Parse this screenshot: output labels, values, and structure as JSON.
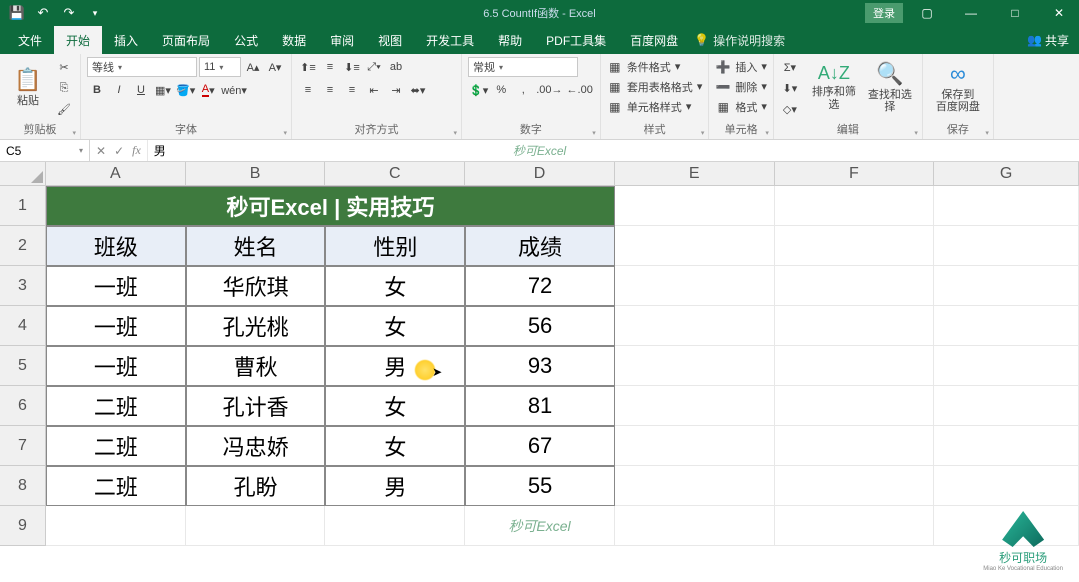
{
  "titlebar": {
    "doc_title": "6.5 CountIf函数 - Excel",
    "login": "登录"
  },
  "tabs": {
    "file": "文件",
    "home": "开始",
    "insert": "插入",
    "layout": "页面布局",
    "formula": "公式",
    "data": "数据",
    "review": "审阅",
    "view": "视图",
    "dev": "开发工具",
    "help": "帮助",
    "pdf": "PDF工具集",
    "baidu": "百度网盘",
    "tellme": "操作说明搜索",
    "share": "共享"
  },
  "ribbon": {
    "clipboard": {
      "paste": "粘贴",
      "label": "剪贴板"
    },
    "font": {
      "name": "等线",
      "size": "11",
      "label": "字体",
      "bold": "B",
      "italic": "I",
      "underline": "U"
    },
    "align": {
      "label": "对齐方式",
      "wrap": "ab"
    },
    "number": {
      "format": "常规",
      "label": "数字"
    },
    "styles": {
      "cond": "条件格式",
      "table": "套用表格格式",
      "cell": "单元格样式",
      "label": "样式"
    },
    "cells": {
      "insert": "插入",
      "delete": "删除",
      "format": "格式",
      "label": "单元格"
    },
    "editing": {
      "sort": "排序和筛选",
      "find": "查找和选择",
      "label": "编辑"
    },
    "save": {
      "btn": "保存到\n百度网盘",
      "label": "保存"
    }
  },
  "formula_bar": {
    "cell_ref": "C5",
    "value": "男",
    "watermark": "秒可Excel"
  },
  "grid": {
    "col_headers": [
      "A",
      "B",
      "C",
      "D",
      "E",
      "F",
      "G"
    ],
    "row_headers": [
      "1",
      "2",
      "3",
      "4",
      "5",
      "6",
      "7",
      "8",
      "9"
    ],
    "title": "秒可Excel | 实用技巧",
    "headers": {
      "class": "班级",
      "name": "姓名",
      "gender": "性别",
      "score": "成绩"
    },
    "rows": [
      {
        "class": "一班",
        "name": "华欣琪",
        "gender": "女",
        "score": "72"
      },
      {
        "class": "一班",
        "name": "孔光桃",
        "gender": "女",
        "score": "56"
      },
      {
        "class": "一班",
        "name": "曹秋",
        "gender": "男",
        "score": "93"
      },
      {
        "class": "二班",
        "name": "孔计香",
        "gender": "女",
        "score": "81"
      },
      {
        "class": "二班",
        "name": "冯忠娇",
        "gender": "女",
        "score": "67"
      },
      {
        "class": "二班",
        "name": "孔盼",
        "gender": "男",
        "score": "55"
      }
    ],
    "watermark9": "秒可Excel"
  },
  "brand": {
    "text": "秒可职场",
    "sub": "Miao Ke Vocational Education"
  }
}
